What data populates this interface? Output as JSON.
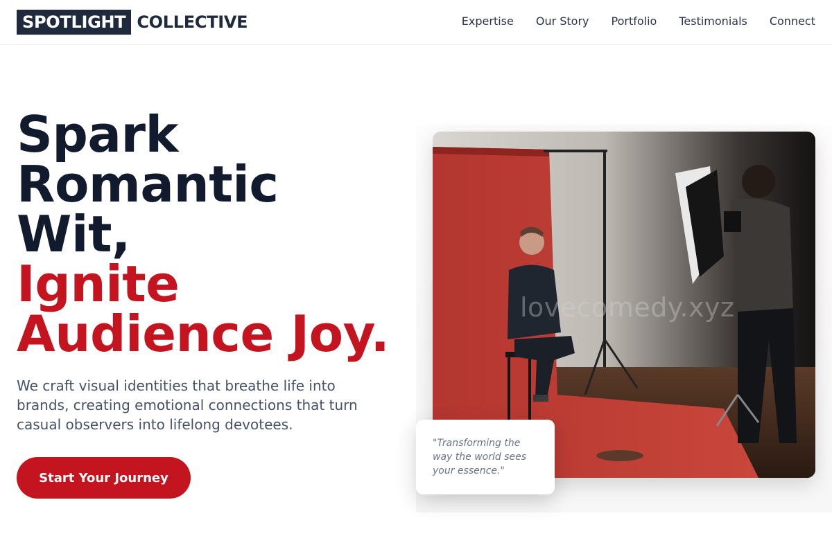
{
  "brand": {
    "highlight": "SPOTLIGHT",
    "rest": "COLLECTIVE"
  },
  "nav": [
    "Expertise",
    "Our Story",
    "Portfolio",
    "Testimonials",
    "Connect"
  ],
  "hero": {
    "line1": "Spark",
    "line2": "Romantic",
    "line3": "Wit,",
    "line4": "Ignite",
    "line5": "Audience Joy.",
    "subtitle": "We craft visual identities that breathe life into brands, creating emotional connections that turn casual observers into lifelong devotees.",
    "cta": "Start Your Journey"
  },
  "image": {
    "watermark": "lovecomedy.xyz"
  },
  "quote": "\"Transforming the way the world sees your essence.\"",
  "colors": {
    "brand_dark": "#1f2a3d",
    "accent_red": "#c3141f",
    "heading": "#121a2e"
  }
}
